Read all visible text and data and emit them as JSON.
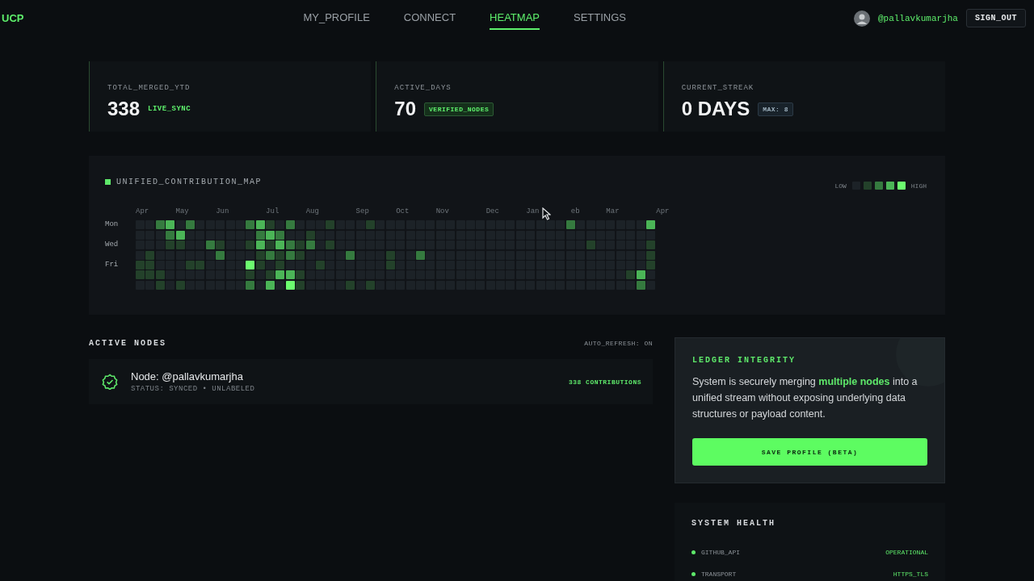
{
  "nav": {
    "logo": "UCP",
    "tabs": [
      {
        "label": "MY_PROFILE",
        "selected": false
      },
      {
        "label": "CONNECT",
        "selected": false
      },
      {
        "label": "HEATMAP",
        "selected": true
      },
      {
        "label": "SETTINGS",
        "selected": false
      }
    ],
    "user": "@pallavkumarjha",
    "sign_out": "SIGN_OUT"
  },
  "stats": [
    {
      "title": "TOTAL_MERGED_YTD",
      "value": "338",
      "badge": {
        "text": "LIVE_SYNC",
        "kind": "plain"
      }
    },
    {
      "title": "ACTIVE_DAYS",
      "value": "70",
      "badge": {
        "text": "VERIFIED_NODES",
        "kind": "green"
      }
    },
    {
      "title": "CURRENT_STREAK",
      "value": "0 DAYS",
      "badge": {
        "text": "MAX: 8",
        "kind": "gray"
      }
    }
  ],
  "heatmap": {
    "title": "UNIFIED_CONTRIBUTION_MAP",
    "legend": {
      "low": "LOW",
      "high": "HIGH",
      "color": [
        "#1c2227",
        "#23412a",
        "#357a3f",
        "#4bb557",
        "#6cfd6f"
      ]
    },
    "months": [
      "Apr",
      "May",
      "Jun",
      "Jul",
      "Aug",
      "Sep",
      "Oct",
      "Nov",
      "Dec",
      "Jan",
      "eb",
      "Mar",
      "Apr"
    ],
    "rows": [
      {
        "label": "Mon",
        "color": [
          "#1c2227",
          "#1c2227",
          "#357a3f",
          "#4bb557",
          "#1c2227",
          "#357a3f",
          "#1c2227",
          "#1c2227",
          "#1c2227",
          "#1c2227",
          "#1c2227",
          "#357a3f",
          "#4bb557",
          "#23412a",
          "#1c2227",
          "#357a3f",
          "#1c2227",
          "#1c2227",
          "#1c2227",
          "#23412a",
          "#1c2227",
          "#1c2227",
          "#1c2227",
          "#23412a",
          "#1c2227",
          "#1c2227",
          "#1c2227",
          "#1c2227",
          "#1c2227",
          "#1c2227",
          "#1c2227",
          "#1c2227",
          "#1c2227",
          "#1c2227",
          "#1c2227",
          "#1c2227",
          "#1c2227",
          "#1c2227",
          "#1c2227",
          "#1c2227",
          "#1c2227",
          "#1c2227",
          "#1c2227",
          "#357a3f",
          "#1c2227",
          "#1c2227",
          "#1c2227",
          "#1c2227",
          "#1c2227",
          "#1c2227",
          "#1c2227",
          "#4bb557"
        ]
      },
      {
        "color": [
          "#1c2227",
          "#1c2227",
          "#1c2227",
          "#357a3f",
          "#4bb557",
          "#1c2227",
          "#1c2227",
          "#1c2227",
          "#1c2227",
          "#1c2227",
          "#1c2227",
          "#1c2227",
          "#357a3f",
          "#4bb557",
          "#357a3f",
          "#1c2227",
          "#1c2227",
          "#23412a",
          "#1c2227",
          "#1c2227",
          "#1c2227",
          "#1c2227",
          "#1c2227",
          "#1c2227",
          "#1c2227",
          "#1c2227",
          "#1c2227",
          "#1c2227",
          "#1c2227",
          "#1c2227",
          "#1c2227",
          "#1c2227",
          "#1c2227",
          "#1c2227",
          "#1c2227",
          "#1c2227",
          "#1c2227",
          "#1c2227",
          "#1c2227",
          "#1c2227",
          "#1c2227",
          "#1c2227",
          "#1c2227",
          "#1c2227",
          "#1c2227",
          "#1c2227",
          "#1c2227",
          "#1c2227",
          "#1c2227",
          "#1c2227",
          "#1c2227",
          "#1c2227"
        ]
      },
      {
        "label": "Wed",
        "color": [
          "#1c2227",
          "#1c2227",
          "#1c2227",
          "#23412a",
          "#23412a",
          "#1c2227",
          "#1c2227",
          "#357a3f",
          "#23412a",
          "#1c2227",
          "#1c2227",
          "#23412a",
          "#4bb557",
          "#23412a",
          "#4bb557",
          "#357a3f",
          "#23412a",
          "#357a3f",
          "#1c2227",
          "#23412a",
          "#1c2227",
          "#1c2227",
          "#1c2227",
          "#1c2227",
          "#1c2227",
          "#1c2227",
          "#1c2227",
          "#1c2227",
          "#1c2227",
          "#1c2227",
          "#1c2227",
          "#1c2227",
          "#1c2227",
          "#1c2227",
          "#1c2227",
          "#1c2227",
          "#1c2227",
          "#1c2227",
          "#1c2227",
          "#1c2227",
          "#1c2227",
          "#1c2227",
          "#1c2227",
          "#1c2227",
          "#1c2227",
          "#23412a",
          "#1c2227",
          "#1c2227",
          "#1c2227",
          "#1c2227",
          "#1c2227",
          "#23412a"
        ]
      },
      {
        "color": [
          "#1c2227",
          "#23412a",
          "#1c2227",
          "#1c2227",
          "#1c2227",
          "#1c2227",
          "#1c2227",
          "#1c2227",
          "#357a3f",
          "#1c2227",
          "#1c2227",
          "#1c2227",
          "#23412a",
          "#357a3f",
          "#23412a",
          "#357a3f",
          "#23412a",
          "#1c2227",
          "#1c2227",
          "#1c2227",
          "#1c2227",
          "#357a3f",
          "#1c2227",
          "#1c2227",
          "#1c2227",
          "#23412a",
          "#1c2227",
          "#1c2227",
          "#357a3f",
          "#1c2227",
          "#1c2227",
          "#1c2227",
          "#1c2227",
          "#1c2227",
          "#1c2227",
          "#1c2227",
          "#1c2227",
          "#1c2227",
          "#1c2227",
          "#1c2227",
          "#1c2227",
          "#1c2227",
          "#1c2227",
          "#1c2227",
          "#1c2227",
          "#1c2227",
          "#1c2227",
          "#1c2227",
          "#1c2227",
          "#1c2227",
          "#1c2227",
          "#23412a"
        ]
      },
      {
        "label": "Fri",
        "color": [
          "#23412a",
          "#23412a",
          "#1c2227",
          "#1c2227",
          "#1c2227",
          "#23412a",
          "#23412a",
          "#1c2227",
          "#1c2227",
          "#1c2227",
          "#1c2227",
          "#6cfd6f",
          "#23412a",
          "#1c2227",
          "#23412a",
          "#1c2227",
          "#1c2227",
          "#1c2227",
          "#23412a",
          "#1c2227",
          "#1c2227",
          "#1c2227",
          "#1c2227",
          "#1c2227",
          "#1c2227",
          "#23412a",
          "#1c2227",
          "#1c2227",
          "#1c2227",
          "#1c2227",
          "#1c2227",
          "#1c2227",
          "#1c2227",
          "#1c2227",
          "#1c2227",
          "#1c2227",
          "#1c2227",
          "#1c2227",
          "#1c2227",
          "#1c2227",
          "#1c2227",
          "#1c2227",
          "#1c2227",
          "#1c2227",
          "#1c2227",
          "#1c2227",
          "#1c2227",
          "#1c2227",
          "#1c2227",
          "#1c2227",
          "#1c2227",
          "#23412a"
        ]
      },
      {
        "color": [
          "#23412a",
          "#23412a",
          "#23412a",
          "#1c2227",
          "#1c2227",
          "#1c2227",
          "#1c2227",
          "#1c2227",
          "#1c2227",
          "#1c2227",
          "#1c2227",
          "#23412a",
          "#1c2227",
          "#23412a",
          "#4bb557",
          "#4bb557",
          "#23412a",
          "#1c2227",
          "#1c2227",
          "#1c2227",
          "#1c2227",
          "#1c2227",
          "#1c2227",
          "#1c2227",
          "#1c2227",
          "#1c2227",
          "#1c2227",
          "#1c2227",
          "#1c2227",
          "#1c2227",
          "#1c2227",
          "#1c2227",
          "#1c2227",
          "#1c2227",
          "#1c2227",
          "#1c2227",
          "#1c2227",
          "#1c2227",
          "#1c2227",
          "#1c2227",
          "#1c2227",
          "#1c2227",
          "#1c2227",
          "#1c2227",
          "#1c2227",
          "#1c2227",
          "#1c2227",
          "#1c2227",
          "#1c2227",
          "#23412a",
          "#4bb557",
          "#1c2227"
        ]
      },
      {
        "color": [
          "#1c2227",
          "#1c2227",
          "#23412a",
          "#1c2227",
          "#23412a",
          "#1c2227",
          "#1c2227",
          "#1c2227",
          "#1c2227",
          "#1c2227",
          "#1c2227",
          "#357a3f",
          "#1c2227",
          "#4bb557",
          "#1c2227",
          "#6cfd6f",
          "#23412a",
          "#1c2227",
          "#1c2227",
          "#1c2227",
          "#1c2227",
          "#23412a",
          "#1c2227",
          "#23412a",
          "#1c2227",
          "#1c2227",
          "#1c2227",
          "#1c2227",
          "#1c2227",
          "#1c2227",
          "#1c2227",
          "#1c2227",
          "#1c2227",
          "#1c2227",
          "#1c2227",
          "#1c2227",
          "#1c2227",
          "#1c2227",
          "#1c2227",
          "#1c2227",
          "#1c2227",
          "#1c2227",
          "#1c2227",
          "#1c2227",
          "#1c2227",
          "#1c2227",
          "#1c2227",
          "#1c2227",
          "#1c2227",
          "#1c2227",
          "#357a3f",
          "#1c2227"
        ]
      }
    ]
  },
  "nodes": {
    "title": "ACTIVE NODES",
    "auto_refresh": "AUTO_REFRESH: ON",
    "items": [
      {
        "name": "Node: @pallavkumarjha",
        "status": "STATUS: SYNCED • UNLABELED",
        "count": "338 CONTRIBUTIONS"
      }
    ]
  },
  "ledger": {
    "title": "LEDGER INTEGRITY",
    "text": "System is securely merging **multiple nodes** into a unified stream without exposing underlying data structures or payload content.",
    "button": "SAVE PROFILE (BETA)"
  },
  "health": {
    "title": "SYSTEM HEALTH",
    "items": [
      {
        "name": "GITHUB_API",
        "value": "OPERATIONAL",
        "color": "#5ee86a"
      },
      {
        "name": "TRANSPORT",
        "value": "HTTPS_TLS",
        "color": "#5ee86a"
      }
    ]
  }
}
